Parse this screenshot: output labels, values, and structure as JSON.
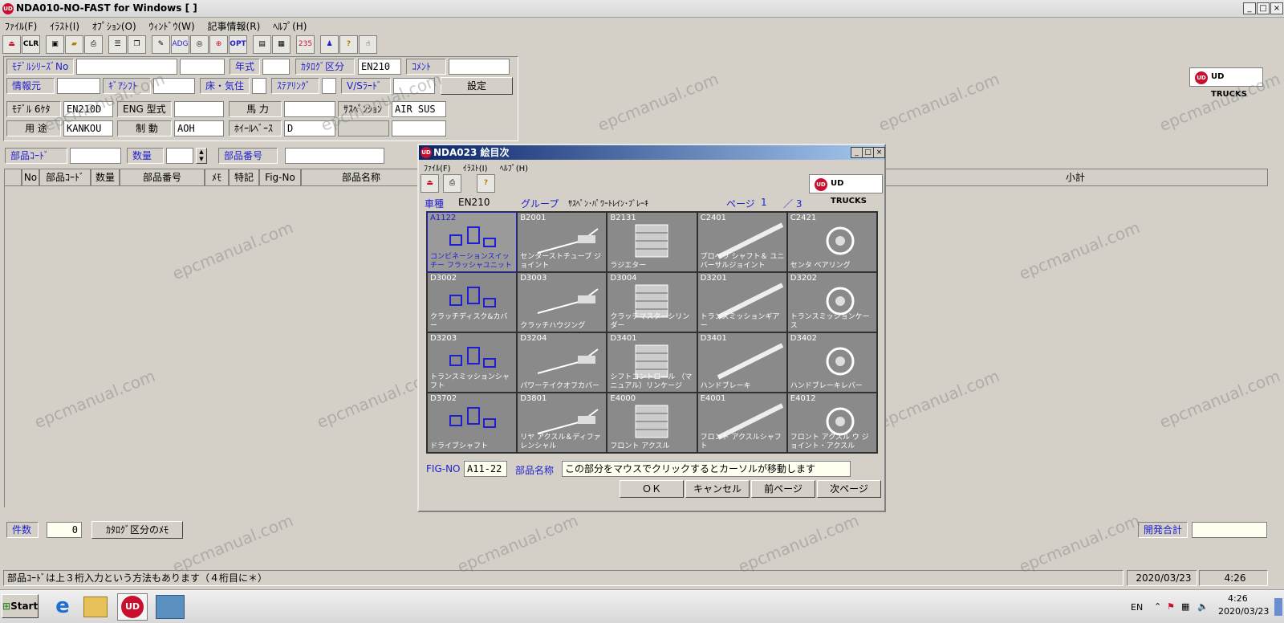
{
  "window": {
    "title": "NDA010-NO-FAST for Windows [ ]",
    "min": "_",
    "max": "□",
    "close": "×"
  },
  "menu": [
    "ﾌｧｲﾙ(F)",
    "ｲﾗｽﾄ(I)",
    "ｵﾌﾟｼｮﾝ(O)",
    "ｳｨﾝﾄﾞｳ(W)",
    "記事情報(R)",
    "ﾍﾙﾌﾟ(H)"
  ],
  "toolbar": {
    "clr": "CLR",
    "adg": "ADG",
    "opt": "OPT",
    "num": "235",
    "help": "?",
    "brand": "UD TRUCKS"
  },
  "form": {
    "model_series_label": "ﾓﾃﾞﾙｼﾘｰｽﾞNo",
    "year_label": "年式",
    "catalog_label": "ｶﾀﾛｸﾞ区分",
    "catalog_value": "EN210",
    "comment_label": "ｺﾒﾝﾄ",
    "source_label": "情報元",
    "gear_label": "ｷﾞｱｼﾌﾄ",
    "floor_label": "床・気住",
    "steering_label": "ｽﾃｱﾘﾝｸﾞ",
    "vs_label": "V/Sﾗｰﾄﾞ",
    "set_button": "設定",
    "model6_label": "ﾓﾃﾞﾙ 6ｹﾀ",
    "model6_value": "EN210D",
    "eng_label": "ENG 型式",
    "hp_label": "馬 力",
    "suspension_label": "ｻｽﾍﾟﾝｼｮﾝ",
    "suspension_value": "AIR SUS",
    "usage_label": "用 途",
    "usage_value": "KANKOU",
    "brake_label": "制 動",
    "brake_value": "AOH",
    "wheelbase_label": "ﾎｲｰﾙﾍﾞｰｽ",
    "wheelbase_value": "D",
    "part_code_label": "部品ｺｰﾄﾞ",
    "qty_label": "数量",
    "part_no_label": "部品番号"
  },
  "table": {
    "columns": [
      "No",
      "部品ｺｰﾄﾞ",
      "数量",
      "部品番号",
      "ﾒﾓ",
      "特記",
      "Fig-No",
      "部品名称",
      "小計"
    ]
  },
  "footer": {
    "count_label": "件数",
    "count_value": "0",
    "memo_button": "ｶﾀﾛｸﾞ区分のﾒﾓ",
    "total_label": "開発合計",
    "status_text": "部品ｺｰﾄﾞは上３桁入力という方法もあります（４桁目に＊）",
    "date": "2020/03/23",
    "time": "4:26"
  },
  "dialog": {
    "title": "NDA023 絵目次",
    "menu": [
      "ﾌｧｲﾙ(F)",
      "ｲﾗｽﾄ(I)",
      "ﾍﾙﾌﾟ(H)"
    ],
    "vehicle_label": "車種",
    "vehicle_value": "EN210",
    "group_label": "グループ",
    "group_value": "ｻｽﾍﾟﾝ･ﾊﾟﾜｰﾄﾚｲﾝ･ﾌﾞﾚｰｷ",
    "page_label": "ページ",
    "page_value": "1",
    "page_total": "／ 3",
    "thumbs": [
      {
        "code": "A1122",
        "name": "コンビネーションスイッチー フラッシャユニット"
      },
      {
        "code": "B2001",
        "name": "センターストチューブ ジョイント"
      },
      {
        "code": "B2131",
        "name": "ラジエター"
      },
      {
        "code": "C2401",
        "name": "プロペラ シャフト＆ ユニバーサルジョイント"
      },
      {
        "code": "C2421",
        "name": "センタ ベアリング"
      },
      {
        "code": "D3002",
        "name": "クラッチディスク&カバー"
      },
      {
        "code": "D3003",
        "name": "クラッチハウジング"
      },
      {
        "code": "D3004",
        "name": "クラッチマスターシリンダー"
      },
      {
        "code": "D3201",
        "name": "トランスミッションギアー"
      },
      {
        "code": "D3202",
        "name": "トランスミッションケース"
      },
      {
        "code": "D3203",
        "name": "トランスミッションシャフト"
      },
      {
        "code": "D3204",
        "name": "パワーテイクオフカバー"
      },
      {
        "code": "D3401",
        "name": "シフトコントロール （マニュアル）リンケージ"
      },
      {
        "code": "D3401",
        "name": "ハンドブレーキ"
      },
      {
        "code": "D3402",
        "name": "ハンドブレーキレバー"
      },
      {
        "code": "D3702",
        "name": "ドライブシャフト"
      },
      {
        "code": "D3801",
        "name": "リヤ アクスル＆ディファレンシャル"
      },
      {
        "code": "E4000",
        "name": "フロント アクスル"
      },
      {
        "code": "E4001",
        "name": "フロント アクスルシャフト"
      },
      {
        "code": "E4012",
        "name": "フロント アクスル ウ ジョイント・アクスル"
      }
    ],
    "fig_label": "FIG-NO",
    "fig_value": "A11-22",
    "part_name_label": "部品名称",
    "part_name_value": "この部分をマウスでクリックするとカーソルが移動します",
    "ok": "ＯＫ",
    "cancel": "キャンセル",
    "prev": "前ページ",
    "next": "次ページ",
    "brand": "UD TRUCKS"
  },
  "taskbar": {
    "start": "Start",
    "lang": "EN",
    "time": "4:26",
    "date": "2020/03/23"
  },
  "watermark": "epcmanual.com",
  "colors": {
    "accent_blue": "#1f1fd0",
    "brand_red": "#c8102e",
    "face": "#d4d0c8"
  }
}
